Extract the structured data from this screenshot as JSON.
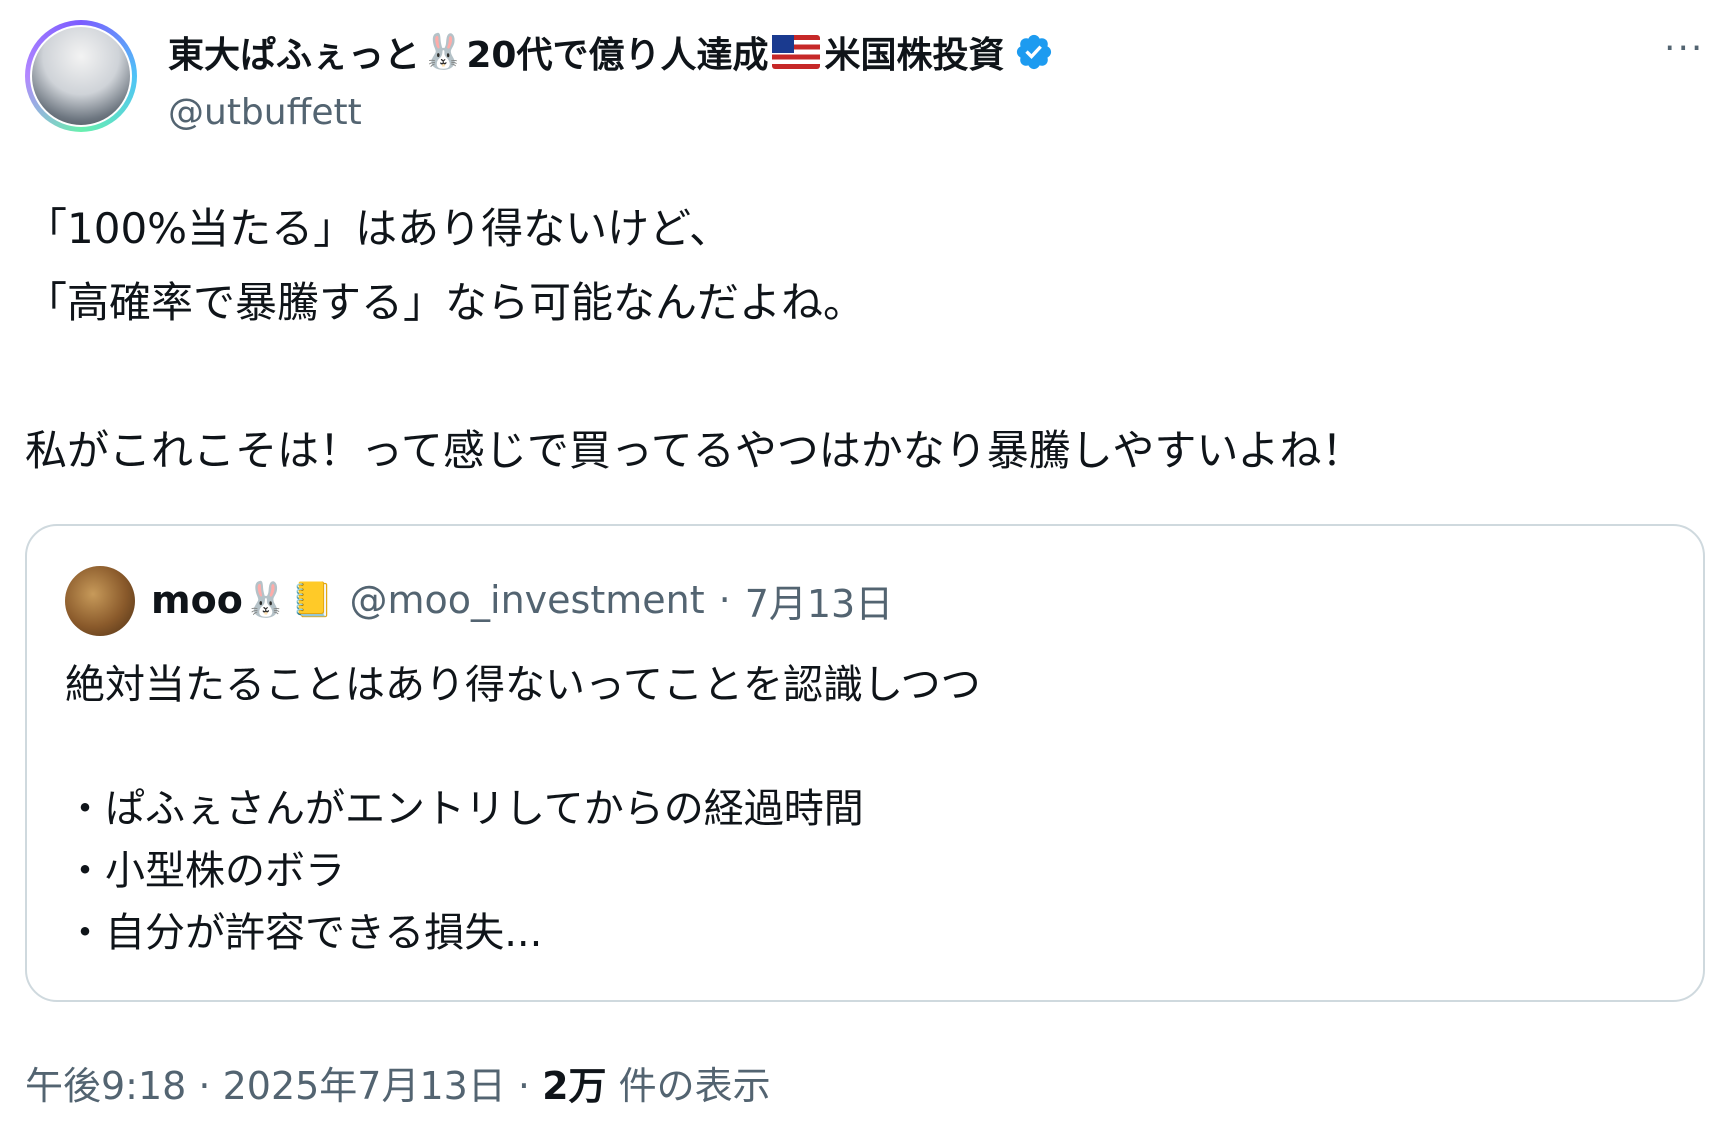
{
  "author": {
    "name_part1": "東大ぱふぇっと",
    "emoji_rabbit": "🐰",
    "name_part2": "20代で億り人達成",
    "name_part3": "米国株投資",
    "handle": "@utbuffett",
    "verified": true
  },
  "menu": {
    "more_label": "···"
  },
  "post": {
    "text": "「100%当たる」はあり得ないけど、\n「高確率で暴騰する」なら可能なんだよね。\n\n私がこれこそは！って感じで買ってるやつはかなり暴騰しやすいよね！"
  },
  "quote": {
    "name": "moo",
    "emoji_rabbit": "🐰",
    "emoji_notebook": "📒",
    "handle": "@moo_investment",
    "separator": "·",
    "date": "7月13日",
    "text": "絶対当たることはあり得ないってことを認識しつつ\n\n・ぱふぇさんがエントリしてからの経過時間\n・小型株のボラ\n・自分が許容できる損失..."
  },
  "footer": {
    "time": "午後9:18",
    "separator1": " · ",
    "date": "2025年7月13日",
    "separator2": " · ",
    "views_count": "2万",
    "views_label": " 件の表示"
  },
  "colors": {
    "text_primary": "#0f1419",
    "text_secondary": "#536471",
    "verified_blue": "#1d9bf0",
    "quote_border": "#cfd9de"
  }
}
